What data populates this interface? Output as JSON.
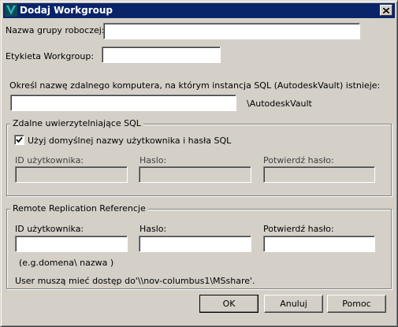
{
  "window": {
    "title": "Dodaj Workgroup",
    "icon": "vault-app-icon",
    "close_icon": "close-icon"
  },
  "form": {
    "group_name_label": "Nazwa grupy roboczej:",
    "group_name_value": "",
    "group_label_label": "Etykieta Workgroup:",
    "group_label_value": "",
    "remote_computer_instruction": "Określ nazwę zdalnego komputera, na którym instancja SQL (AutodeskVault) istnieje:",
    "remote_computer_value": "",
    "instance_suffix": "\\AutodeskVault"
  },
  "sql_credentials": {
    "title": "Zdalne uwierzytelniające SQL",
    "use_default_label": "Użyj domyślnej nazwy użytkownika i hasła SQL",
    "use_default_checked": true,
    "user_id_label": "ID użytkownika:",
    "password_label": "Haslo:",
    "confirm_password_label": "Potwierdź hasło:"
  },
  "replication": {
    "title": "Remote Replication Referencje",
    "user_id_label": "ID użytkownika:",
    "password_label": "Haslo:",
    "confirm_password_label": "Potwierdź hasło:",
    "example_hint": "(e.g.domena\\ nazwa   )",
    "access_note": "User muszą mieć dostęp do'\\\\nov-columbus1\\MSshare'."
  },
  "buttons": {
    "ok": "OK",
    "cancel": "Anuluj",
    "help": "Pomoc"
  },
  "colors": {
    "titlebar": "#0a246a",
    "face": "#d4d0c8",
    "accent_teal": "#1b9aa8"
  }
}
